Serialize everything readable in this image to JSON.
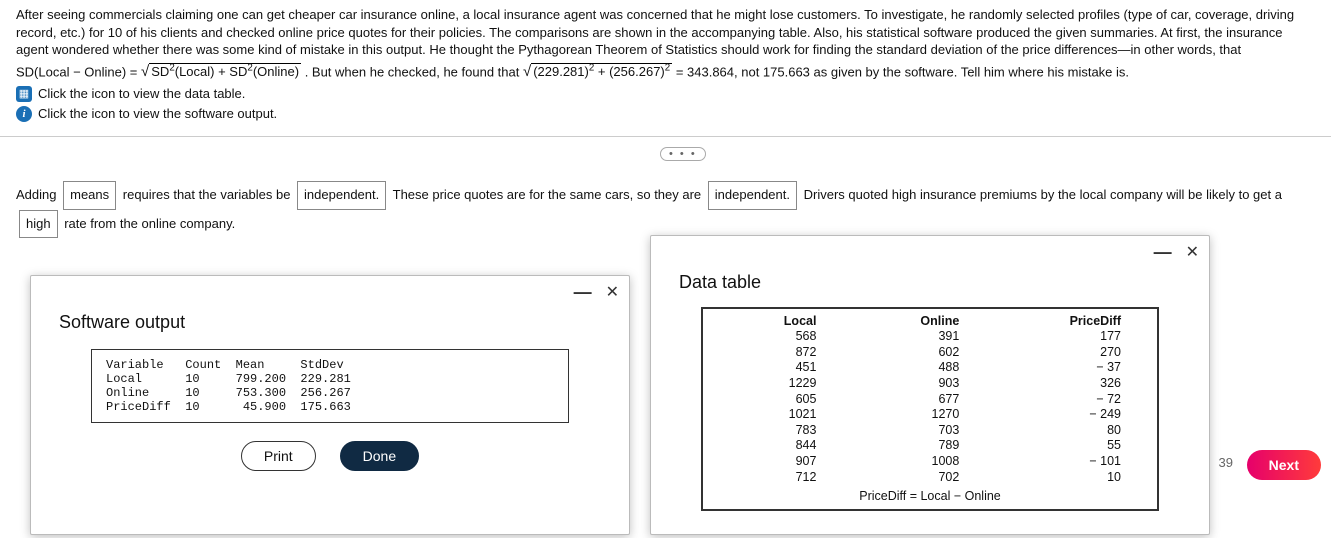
{
  "problem": {
    "paragraph": "After seeing commercials claiming one can get cheaper car insurance online, a local insurance agent was concerned that he might lose customers. To investigate, he randomly selected profiles (type of car, coverage, driving record, etc.) for 10 of his clients and checked online price quotes for their policies. The comparisons are shown in the accompanying table. Also, his statistical software produced the given summaries. At first, the insurance agent wondered whether there was some kind of mistake in this output. He thought the Pythagorean Theorem of Statistics should work for finding the standard deviation of the price differences—in other words, that",
    "formula_lhs": "SD(Local − Online) = ",
    "formula_rhs_tail": ". But when he checked, he found that ",
    "formula_nums_tail": " = 343.864, not 175.663 as given by the software. Tell him where his mistake is.",
    "link1": "Click the icon to view the data table.",
    "link2": "Click the icon to view the software output."
  },
  "answer": {
    "t1": "Adding",
    "sel1": "means",
    "t2": "requires that the variables be",
    "sel2": "independent.",
    "t3": "These price quotes are for the same cars, so they are",
    "sel3": "independent.",
    "t4": "Drivers quoted high insurance premiums by the local company will be likely to get a",
    "sel4": "high",
    "t5": "rate from the online company."
  },
  "software": {
    "title": "Software output",
    "header": "Variable   Count  Mean     StdDev",
    "r1": "Local      10     799.200  229.281",
    "r2": "Online     10     753.300  256.267",
    "r3": "PriceDiff  10      45.900  175.663",
    "print": "Print",
    "done": "Done"
  },
  "datatable": {
    "title": "Data table",
    "cols": {
      "c1": "Local",
      "c2": "Online",
      "c3": "PriceDiff"
    },
    "rows": [
      {
        "local": "568",
        "online": "391",
        "diff": "177"
      },
      {
        "local": "872",
        "online": "602",
        "diff": "270"
      },
      {
        "local": "451",
        "online": "488",
        "diff": "− 37"
      },
      {
        "local": "1229",
        "online": "903",
        "diff": "326"
      },
      {
        "local": "605",
        "online": "677",
        "diff": "− 72"
      },
      {
        "local": "1021",
        "online": "1270",
        "diff": "− 249"
      },
      {
        "local": "783",
        "online": "703",
        "diff": "80"
      },
      {
        "local": "844",
        "online": "789",
        "diff": "55"
      },
      {
        "local": "907",
        "online": "1008",
        "diff": "− 101"
      },
      {
        "local": "712",
        "online": "702",
        "diff": "10"
      }
    ],
    "footer": "PriceDiff = Local − Online"
  },
  "nav": {
    "badge": "39",
    "next": "Next"
  },
  "glyphs": {
    "ellipsis": "• • •",
    "minimize": "—",
    "close": "✕"
  }
}
